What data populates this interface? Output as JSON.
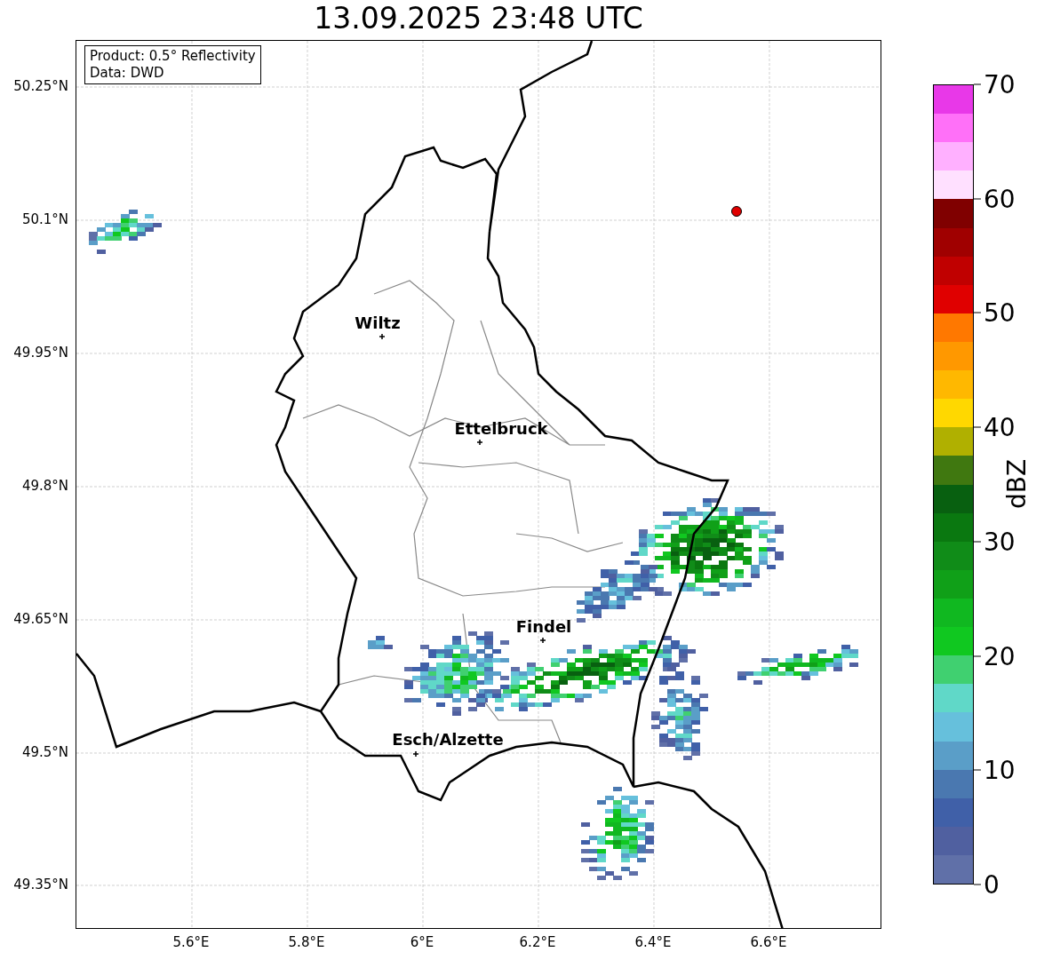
{
  "title": "13.09.2025 23:48 UTC",
  "info_box": [
    "Product: 0.5° Reflectivity",
    "Data: DWD"
  ],
  "places": [
    {
      "name": "Wiltz"
    },
    {
      "name": "Ettelbruck"
    },
    {
      "name": "Findel"
    },
    {
      "name": "Esch/Alzette"
    }
  ],
  "lat_ticks": [
    "50.25°N",
    "50.1°N",
    "49.95°N",
    "49.8°N",
    "49.65°N",
    "49.5°N",
    "49.35°N"
  ],
  "lon_ticks": [
    "5.6°E",
    "5.8°E",
    "6°E",
    "6.2°E",
    "6.4°E",
    "6.6°E"
  ],
  "colorbar": {
    "label": "dBZ",
    "ticks": [
      "70",
      "60",
      "50",
      "40",
      "30",
      "20",
      "10",
      "0"
    ],
    "bins": [
      {
        "color": "#e838e8"
      },
      {
        "color": "#ff70f8"
      },
      {
        "color": "#ffb0ff"
      },
      {
        "color": "#ffe0ff"
      },
      {
        "color": "#800000"
      },
      {
        "color": "#a00000"
      },
      {
        "color": "#c00000"
      },
      {
        "color": "#e00000"
      },
      {
        "color": "#ff7800"
      },
      {
        "color": "#ff9800"
      },
      {
        "color": "#ffb800"
      },
      {
        "color": "#ffd800"
      },
      {
        "color": "#b0b000"
      },
      {
        "color": "#407810"
      },
      {
        "color": "#086010"
      },
      {
        "color": "#0a7810"
      },
      {
        "color": "#108c18"
      },
      {
        "color": "#10a018"
      },
      {
        "color": "#10b820"
      },
      {
        "color": "#10c820"
      },
      {
        "color": "#40d070"
      },
      {
        "color": "#60d8c8"
      },
      {
        "color": "#66c0dc"
      },
      {
        "color": "#5a9ec8"
      },
      {
        "color": "#4a78b0"
      },
      {
        "color": "#4060a8"
      },
      {
        "color": "#5060a0"
      },
      {
        "color": "#6070a8"
      }
    ]
  }
}
